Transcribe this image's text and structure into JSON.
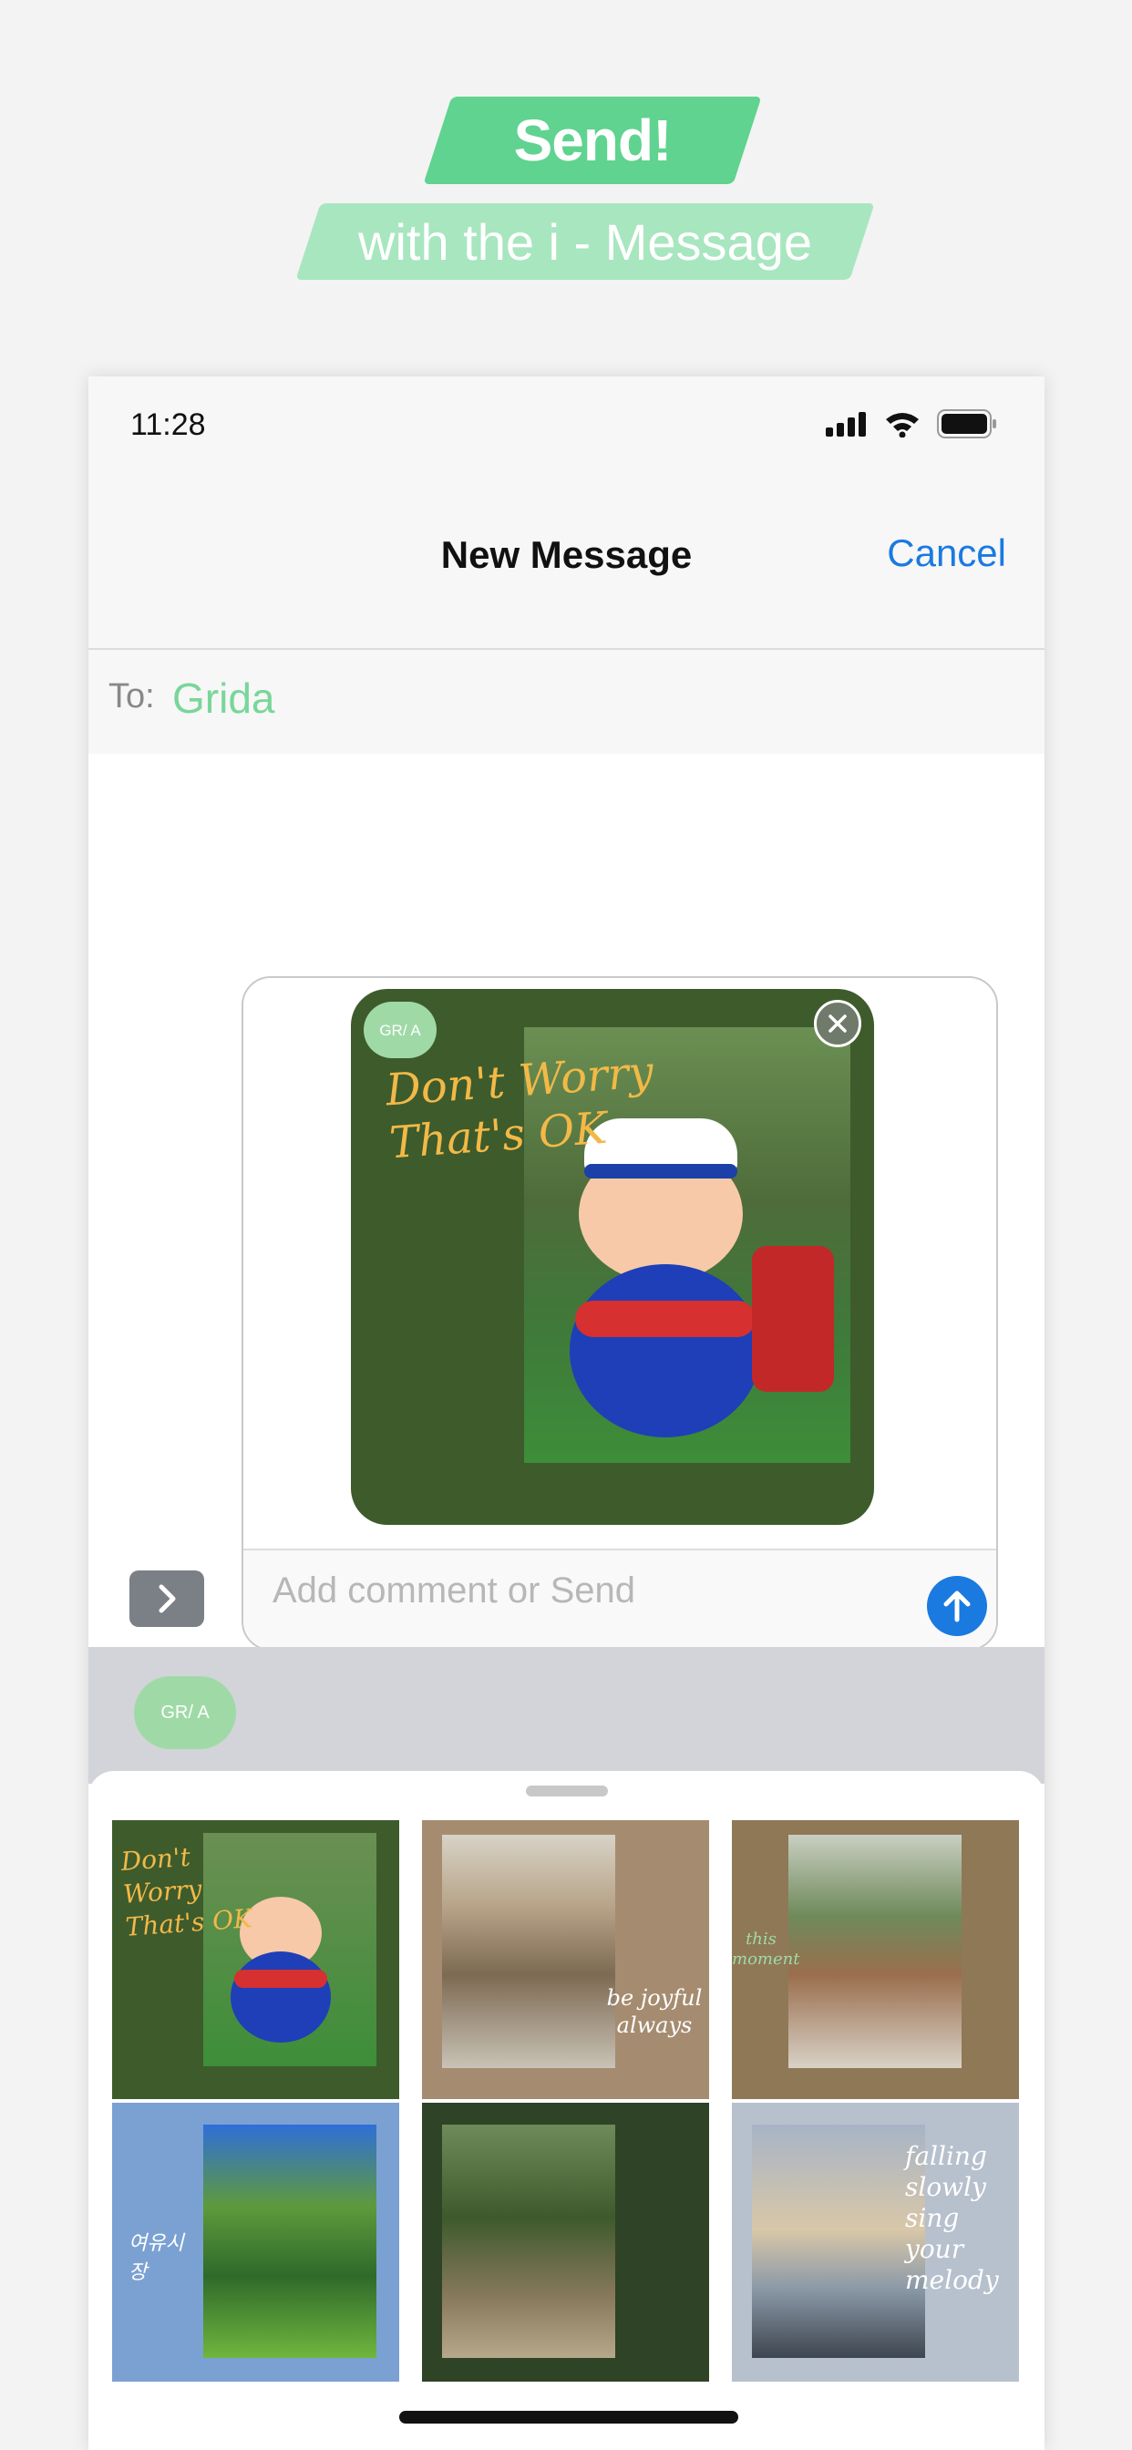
{
  "promo": {
    "headline": "Send!",
    "subline": "with the i - Message"
  },
  "status_bar": {
    "time": "11:28"
  },
  "nav": {
    "title": "New Message",
    "cancel_label": "Cancel"
  },
  "to_field": {
    "label": "To:",
    "value": "Grida"
  },
  "compose": {
    "placeholder": "Add comment or Send",
    "card_text": "Don't Worry That's OK",
    "card_logo": "GR/ A"
  },
  "app_strip": {
    "logo": "GR/ A"
  },
  "gallery": {
    "tiles": [
      {
        "text": "Don't Worry That's OK",
        "bg": "#3e5b2c"
      },
      {
        "text": "be joyful always",
        "bg": "#a58c70"
      },
      {
        "text": "this moment",
        "bg": "#8f7856"
      },
      {
        "text": "여유시장",
        "bg": "#7ba1d2"
      },
      {
        "text": "",
        "bg": "#2f4326"
      },
      {
        "text": "falling slowly sing your melody",
        "bg": "#b7c0cd"
      }
    ]
  },
  "colors": {
    "accent_green": "#5fd38f",
    "light_green": "#a8e6bf",
    "ios_blue": "#1a7ae0"
  }
}
